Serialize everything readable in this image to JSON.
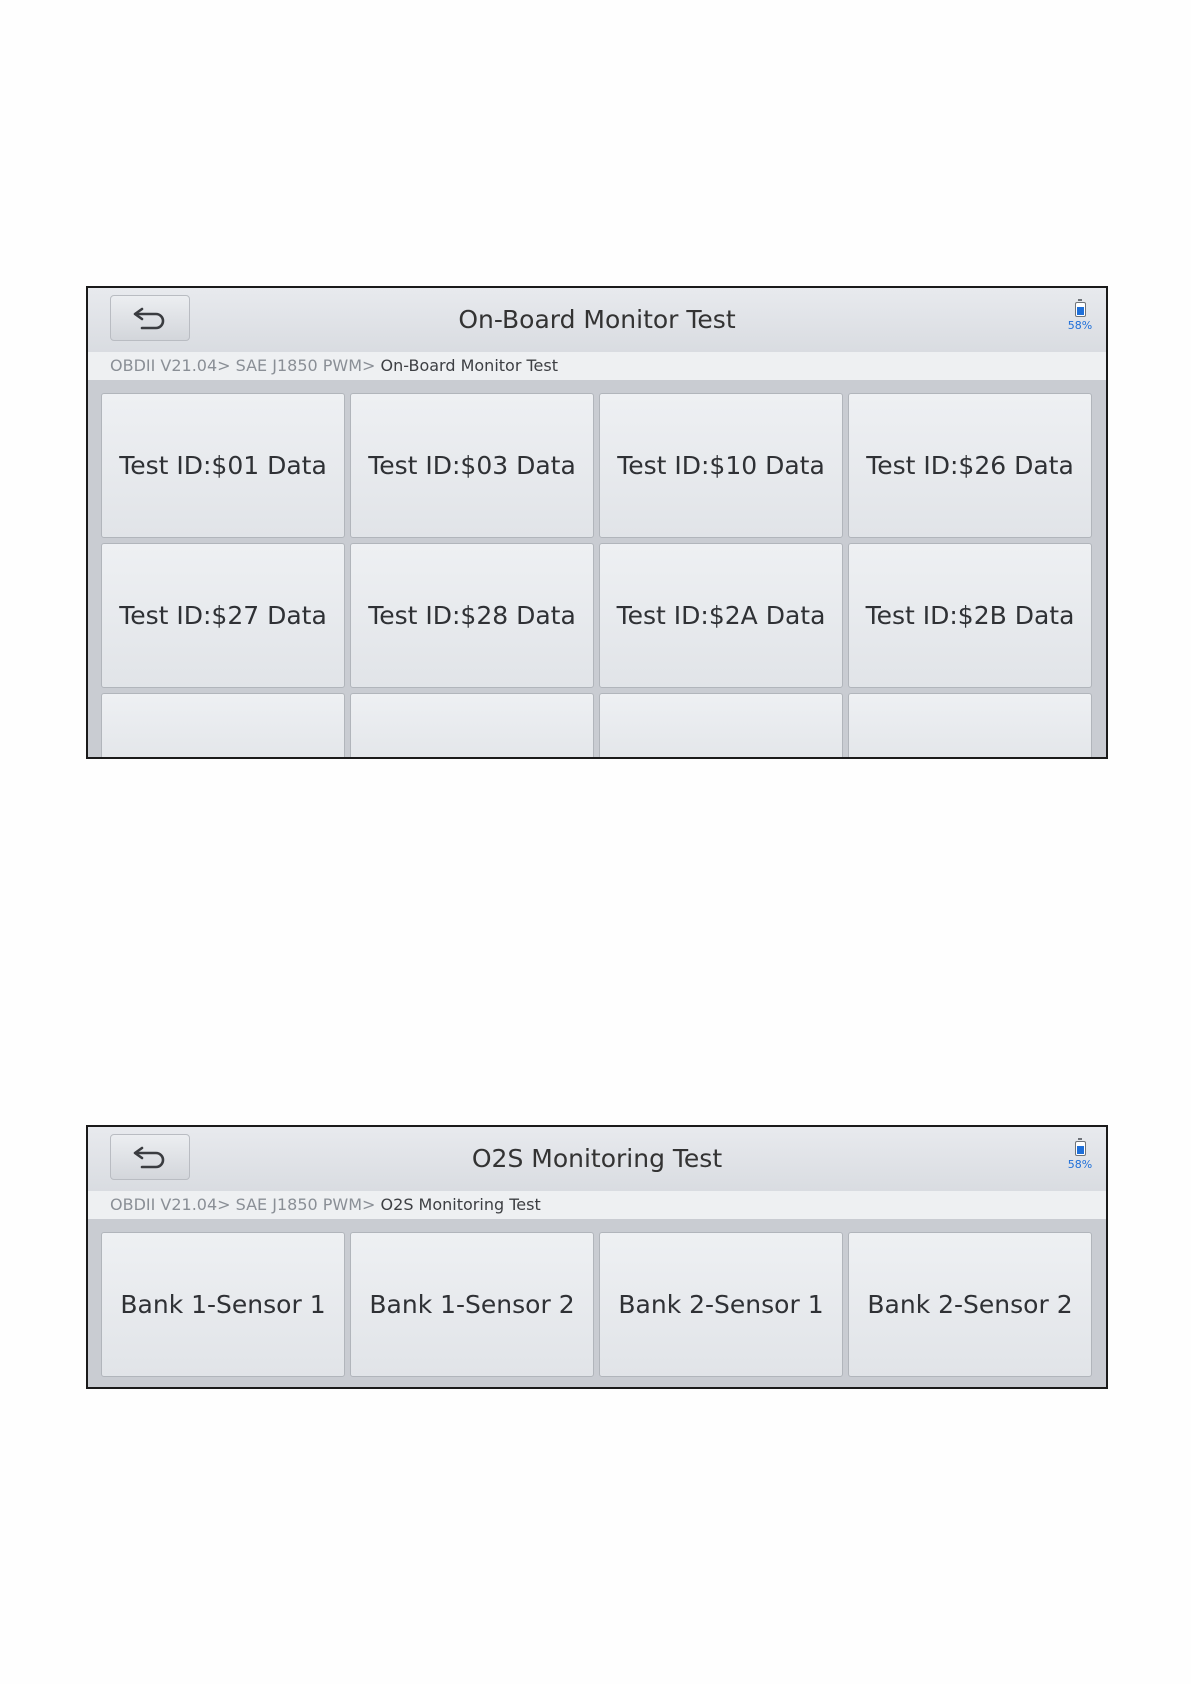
{
  "screens": [
    {
      "title": "On-Board Monitor Test",
      "battery": "58%",
      "breadcrumb": {
        "path": "OBDII V21.04> SAE J1850 PWM>",
        "current": " On-Board Monitor Test"
      },
      "tiles": [
        "Test ID:$01 Data",
        "Test ID:$03 Data",
        "Test ID:$10 Data",
        "Test ID:$26 Data",
        "Test ID:$27 Data",
        "Test ID:$28 Data",
        "Test ID:$2A Data",
        "Test ID:$2B Data"
      ]
    },
    {
      "title": "O2S Monitoring Test",
      "battery": "58%",
      "breadcrumb": {
        "path": "OBDII V21.04> SAE J1850 PWM>",
        "current": " O2S Monitoring Test"
      },
      "tiles": [
        "Bank 1-Sensor 1",
        "Bank 1-Sensor 2",
        "Bank 2-Sensor 1",
        "Bank 2-Sensor 2"
      ]
    }
  ]
}
